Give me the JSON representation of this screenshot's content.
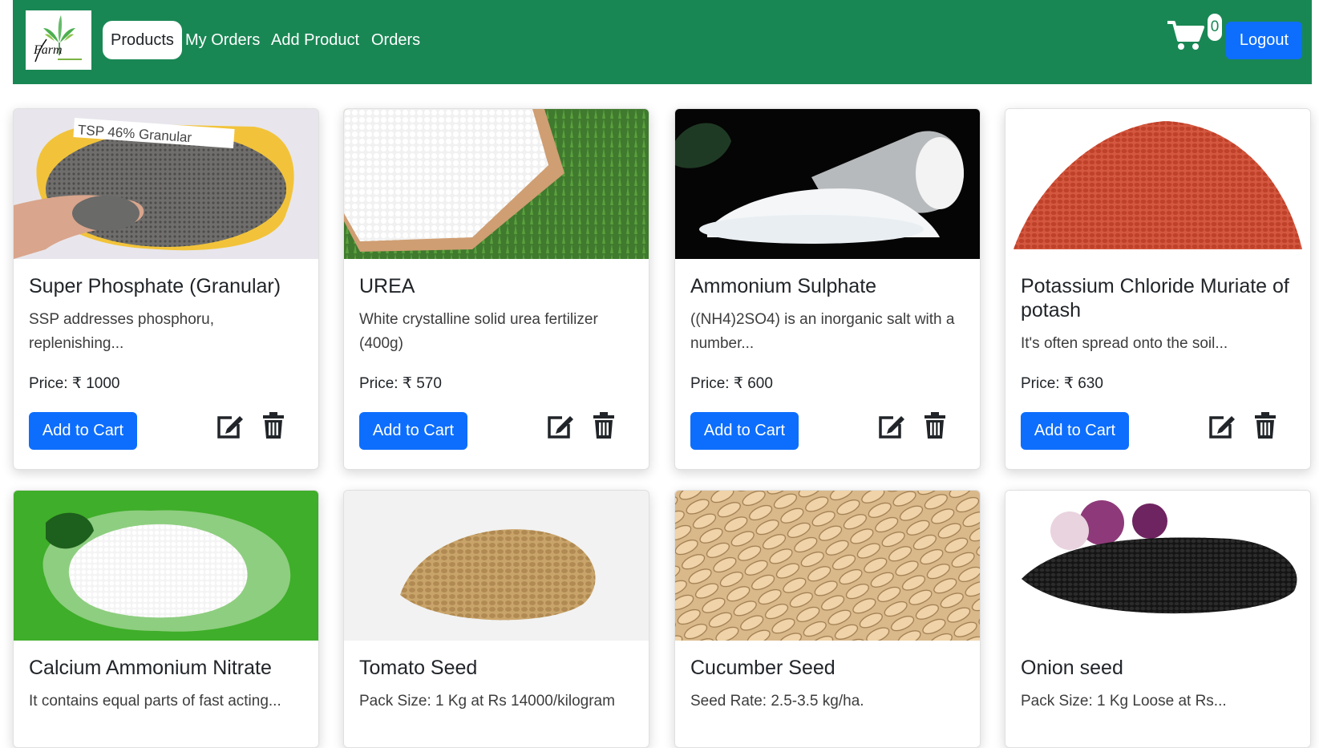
{
  "nav": {
    "logo_text": "Farm",
    "links": [
      {
        "label": "Products",
        "active": true
      },
      {
        "label": "My Orders"
      },
      {
        "label": "Add Product"
      },
      {
        "label": "Orders"
      }
    ],
    "cart_count": "0",
    "logout_label": "Logout",
    "icons": [
      "cart-icon"
    ],
    "colors": {
      "navbar": "#198754",
      "primary": "#0d6efd"
    }
  },
  "products": [
    {
      "title": "Super Phosphate (Granular)",
      "description": "SSP addresses phosphoru, replenishing...",
      "price": "Price: ₹ 1000",
      "add_label": "Add to Cart",
      "image_label": "TSP 46% Granular"
    },
    {
      "title": "UREA",
      "description": "White crystalline solid urea fertilizer (400g)",
      "price": "Price: ₹ 570",
      "add_label": "Add to Cart"
    },
    {
      "title": "Ammonium Sulphate",
      "description": "((NH4)2SO4) is an inorganic salt with a number...",
      "price": "Price: ₹ 600",
      "add_label": "Add to Cart"
    },
    {
      "title": "Potassium Chloride Muriate of potash",
      "description": "It's often spread onto the soil...",
      "price": "Price: ₹ 630",
      "add_label": "Add to Cart"
    },
    {
      "title": "Calcium Ammonium Nitrate",
      "description": "It contains equal parts of fast acting..."
    },
    {
      "title": "Tomato Seed",
      "description": "Pack Size: 1 Kg at Rs 14000/kilogram"
    },
    {
      "title": "Cucumber Seed",
      "description": "Seed Rate: 2.5-3.5 kg/ha."
    },
    {
      "title": "Onion seed",
      "description": "Pack Size: 1 Kg Loose at Rs..."
    }
  ]
}
